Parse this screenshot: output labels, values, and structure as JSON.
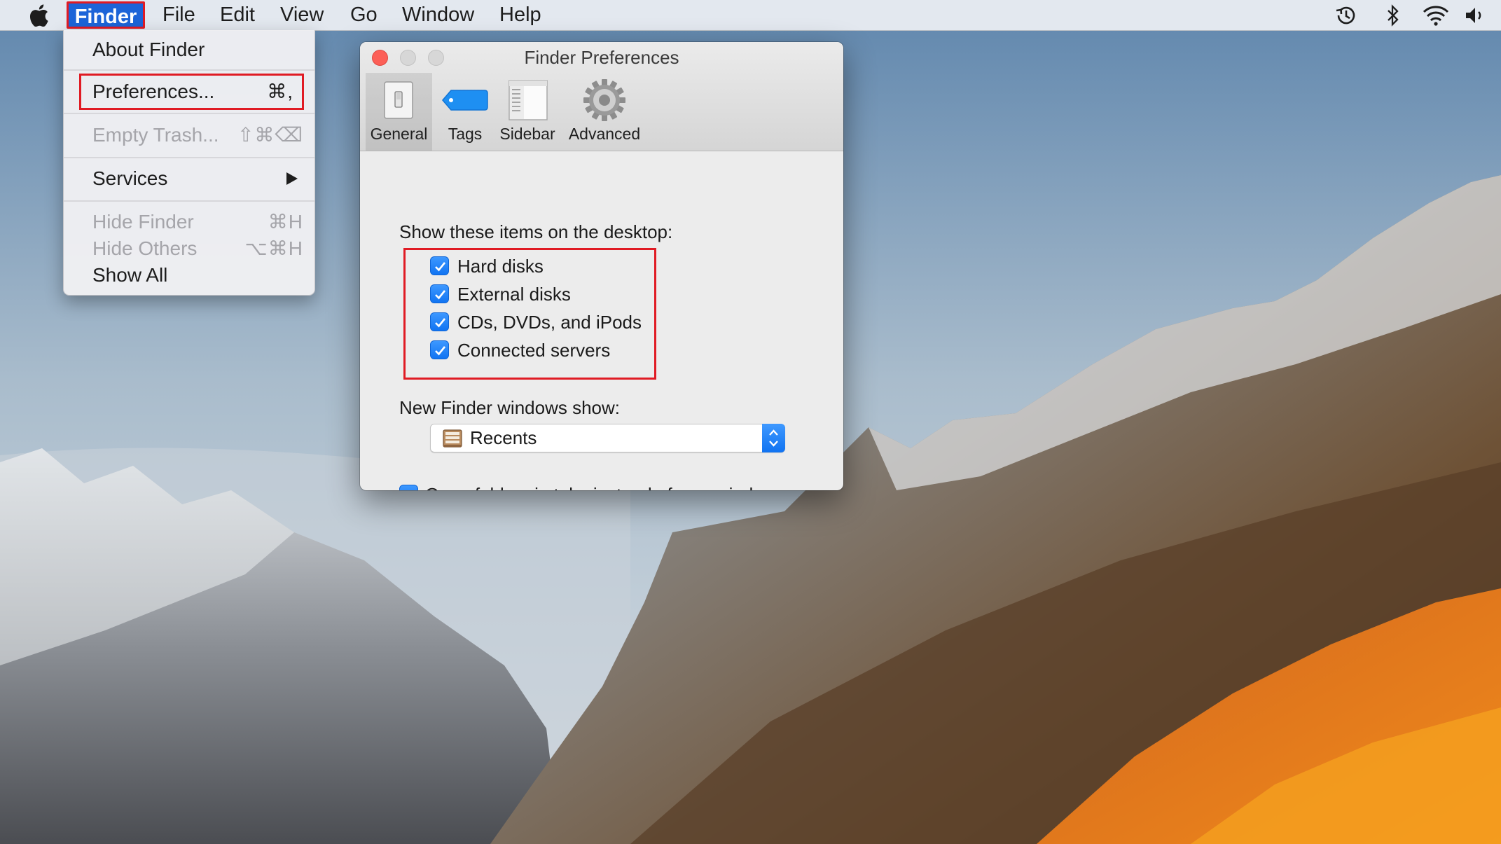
{
  "menubar": {
    "items": [
      "Finder",
      "File",
      "Edit",
      "View",
      "Go",
      "Window",
      "Help"
    ]
  },
  "finder_menu": {
    "about": "About Finder",
    "preferences": "Preferences...",
    "preferences_shortcut": "⌘,",
    "empty_trash": "Empty Trash...",
    "empty_trash_shortcut": "⇧⌘⌫",
    "services": "Services",
    "hide_finder": "Hide Finder",
    "hide_finder_shortcut": "⌘H",
    "hide_others": "Hide Others",
    "hide_others_shortcut": "⌥⌘H",
    "show_all": "Show All"
  },
  "prefs_window": {
    "title": "Finder Preferences",
    "tabs": [
      "General",
      "Tags",
      "Sidebar",
      "Advanced"
    ],
    "active_tab": "General",
    "desktop_heading": "Show these items on the desktop:",
    "desktop_items": [
      {
        "label": "Hard disks",
        "checked": true
      },
      {
        "label": "External disks",
        "checked": true
      },
      {
        "label": "CDs, DVDs, and iPods",
        "checked": true
      },
      {
        "label": "Connected servers",
        "checked": true
      }
    ],
    "new_window_heading": "New Finder windows show:",
    "new_window_value": "Recents",
    "open_in_tabs": {
      "label": "Open folders in tabs instead of new windows",
      "checked": true
    }
  },
  "status_icons": [
    "time-machine-icon",
    "bluetooth-icon",
    "wifi-icon",
    "volume-icon"
  ],
  "colors": {
    "highlight": "#e01b24",
    "accent": "#1c64d8",
    "checkbox": "#1a7cf5",
    "close_button": "#fc5f57"
  }
}
